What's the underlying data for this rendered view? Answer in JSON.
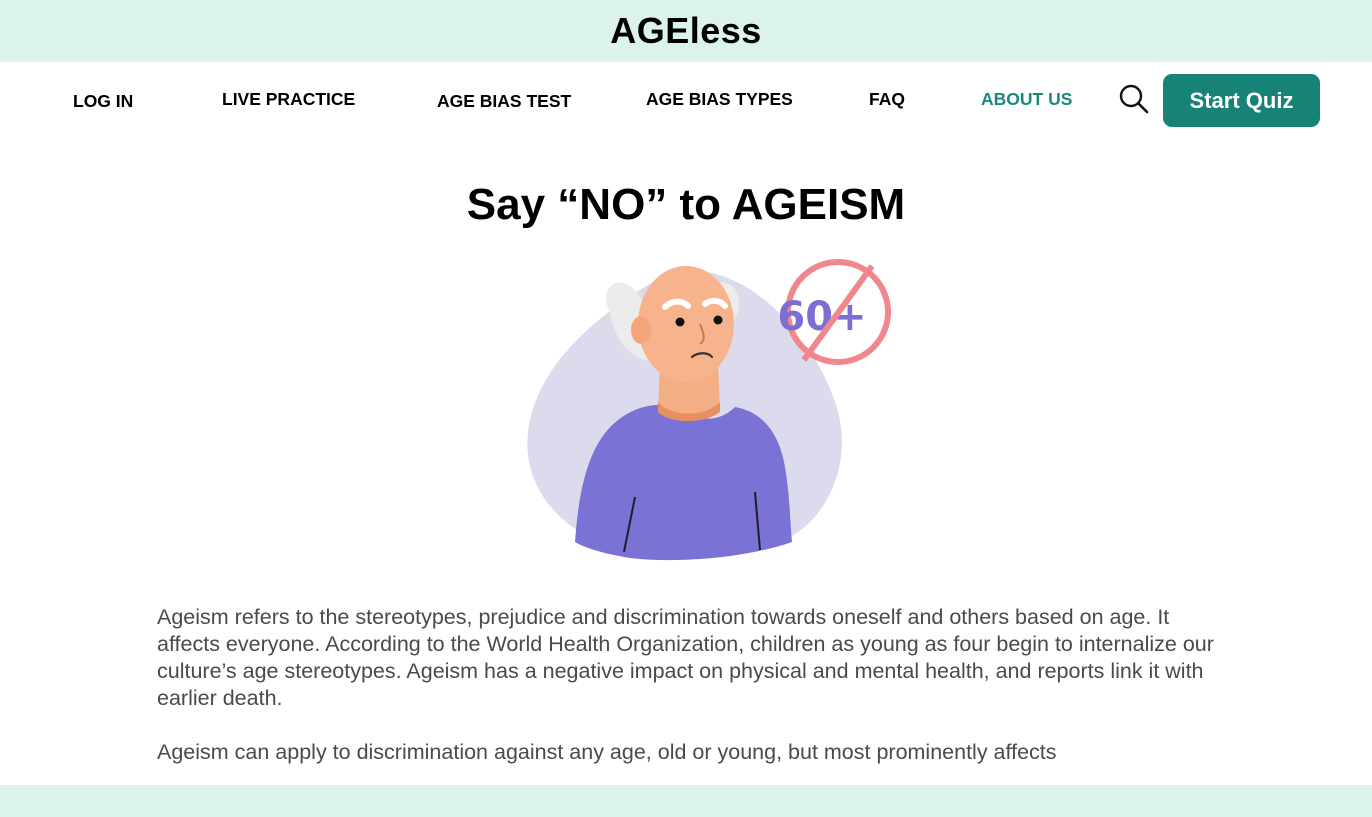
{
  "header": {
    "brand": "AGEless"
  },
  "nav": {
    "items": [
      {
        "label": "LOG IN"
      },
      {
        "label": "LIVE PRACTICE"
      },
      {
        "label": "AGE BIAS TEST"
      },
      {
        "label": "AGE BIAS TYPES"
      },
      {
        "label": "FAQ"
      },
      {
        "label": "ABOUT US"
      }
    ],
    "search_icon": "search-icon",
    "start_quiz_label": "Start Quiz",
    "active_color": "#198a7d"
  },
  "main": {
    "title": "Say “NO” to AGEISM",
    "badge_text": "60+",
    "paragraphs": [
      "Ageism refers to the stereotypes, prejudice and discrimination towards oneself and others based on age. It affects everyone. According to the World Health Organization, children as young as four begin to internalize our culture’s age stereotypes. Ageism has a negative impact on physical and mental health, and reports link it with earlier death.",
      "Ageism can apply to discrimination against any age, old or young, but most prominently affects"
    ]
  },
  "colors": {
    "mint": "#dbf3e8",
    "teal": "#178276",
    "text_gray": "#4a4a4a"
  }
}
